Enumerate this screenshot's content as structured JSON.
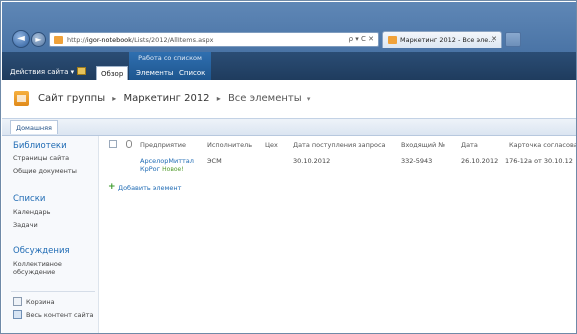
{
  "browser": {
    "url_prefix": "http://",
    "url_host": "igor-notebook",
    "url_path": "/Lists/2012/AllItems.aspx",
    "address_controls": "ρ ▾ C ✕",
    "tab_title": "Маркетинг 2012 - Все эле...",
    "tab_close": "✕",
    "back": "◄",
    "forward": "►"
  },
  "ribbon": {
    "site_actions": "Действия сайта ▾",
    "context_group": "Работа со списком",
    "tabs": [
      "Обзор",
      "Элементы",
      "Список"
    ]
  },
  "breadcrumb": {
    "site": "Сайт группы",
    "sep1": "▸",
    "list": "Маркетинг 2012",
    "sep2": "▸",
    "view": "Все элементы",
    "arrow": "▾"
  },
  "topnav": {
    "home": "Домашняя"
  },
  "quick_launch": {
    "libraries_heading": "Библиотеки",
    "libraries": [
      "Страницы сайта",
      "Общие документы"
    ],
    "lists_heading": "Списки",
    "lists": [
      "Календарь",
      "Задачи"
    ],
    "discussions_heading": "Обсуждения",
    "discussions": [
      "Коллективное",
      "обсуждение"
    ],
    "recycle": "Корзина",
    "all_content": "Весь контент сайта"
  },
  "list": {
    "headers": [
      "Предприятие",
      "Исполнитель",
      "Цех",
      "Дата поступления запроса",
      "Входящий №",
      "Дата",
      "Карточка согласова"
    ],
    "row": {
      "company_line1": "АрселорМиттал",
      "company_line2": "КрРог",
      "new_badge": "Новое!",
      "executor": "ЭСМ",
      "workshop": "",
      "request_date": "30.10.2012",
      "incoming_no": "332-5943",
      "date": "26.10.2012",
      "card": "176-12а от 30.10.12"
    },
    "add_item": "Добавить элемент"
  }
}
